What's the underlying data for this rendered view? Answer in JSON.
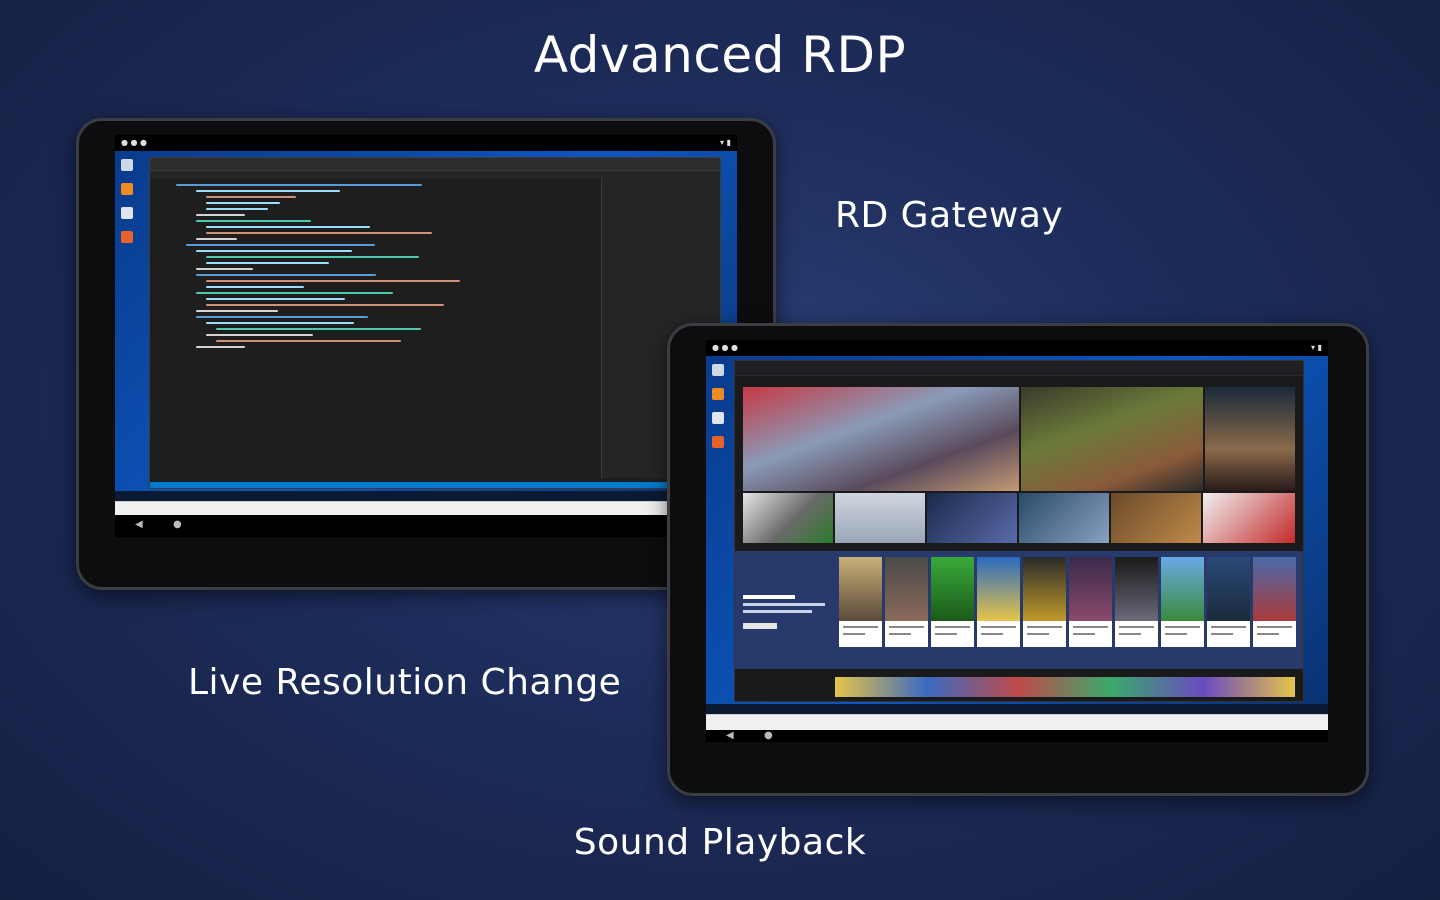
{
  "captions": {
    "title": "Advanced RDP",
    "gateway": "RD Gateway",
    "resolution": "Live Resolution Change",
    "sound": "Sound Playback"
  },
  "colors": {
    "background": "#1d2c5a",
    "tablet_frame": "#0d0d0f",
    "desktop_blue": "#0c57c0",
    "ide_background": "#1e1e1e",
    "ide_status": "#007acc",
    "store_background": "#1a1a1d",
    "store_band": "#283a6b"
  },
  "icons": [
    "back-triangle-icon",
    "home-circle-icon",
    "wifi-icon",
    "battery-icon"
  ]
}
